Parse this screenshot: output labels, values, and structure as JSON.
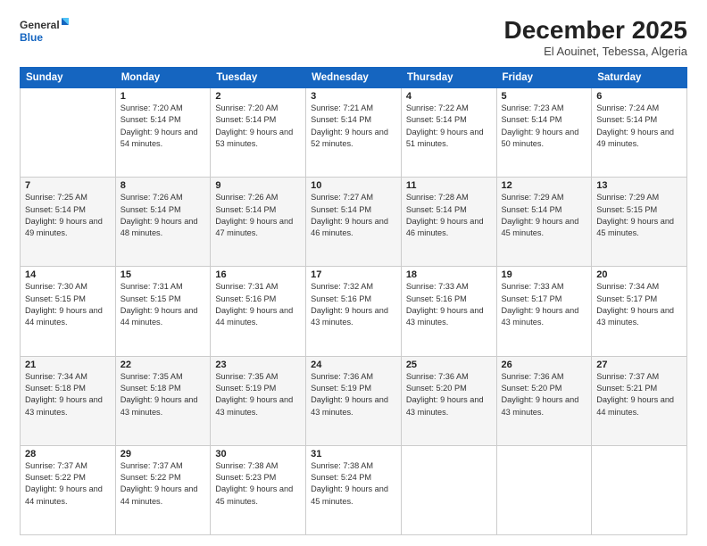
{
  "header": {
    "logo_line1": "General",
    "logo_line2": "Blue",
    "title": "December 2025",
    "subtitle": "El Aouinet, Tebessa, Algeria"
  },
  "days": [
    "Sunday",
    "Monday",
    "Tuesday",
    "Wednesday",
    "Thursday",
    "Friday",
    "Saturday"
  ],
  "weeks": [
    [
      {
        "num": "",
        "sunrise": "",
        "sunset": "",
        "daylight": ""
      },
      {
        "num": "1",
        "sunrise": "Sunrise: 7:20 AM",
        "sunset": "Sunset: 5:14 PM",
        "daylight": "Daylight: 9 hours and 54 minutes."
      },
      {
        "num": "2",
        "sunrise": "Sunrise: 7:20 AM",
        "sunset": "Sunset: 5:14 PM",
        "daylight": "Daylight: 9 hours and 53 minutes."
      },
      {
        "num": "3",
        "sunrise": "Sunrise: 7:21 AM",
        "sunset": "Sunset: 5:14 PM",
        "daylight": "Daylight: 9 hours and 52 minutes."
      },
      {
        "num": "4",
        "sunrise": "Sunrise: 7:22 AM",
        "sunset": "Sunset: 5:14 PM",
        "daylight": "Daylight: 9 hours and 51 minutes."
      },
      {
        "num": "5",
        "sunrise": "Sunrise: 7:23 AM",
        "sunset": "Sunset: 5:14 PM",
        "daylight": "Daylight: 9 hours and 50 minutes."
      },
      {
        "num": "6",
        "sunrise": "Sunrise: 7:24 AM",
        "sunset": "Sunset: 5:14 PM",
        "daylight": "Daylight: 9 hours and 49 minutes."
      }
    ],
    [
      {
        "num": "7",
        "sunrise": "Sunrise: 7:25 AM",
        "sunset": "Sunset: 5:14 PM",
        "daylight": "Daylight: 9 hours and 49 minutes."
      },
      {
        "num": "8",
        "sunrise": "Sunrise: 7:26 AM",
        "sunset": "Sunset: 5:14 PM",
        "daylight": "Daylight: 9 hours and 48 minutes."
      },
      {
        "num": "9",
        "sunrise": "Sunrise: 7:26 AM",
        "sunset": "Sunset: 5:14 PM",
        "daylight": "Daylight: 9 hours and 47 minutes."
      },
      {
        "num": "10",
        "sunrise": "Sunrise: 7:27 AM",
        "sunset": "Sunset: 5:14 PM",
        "daylight": "Daylight: 9 hours and 46 minutes."
      },
      {
        "num": "11",
        "sunrise": "Sunrise: 7:28 AM",
        "sunset": "Sunset: 5:14 PM",
        "daylight": "Daylight: 9 hours and 46 minutes."
      },
      {
        "num": "12",
        "sunrise": "Sunrise: 7:29 AM",
        "sunset": "Sunset: 5:14 PM",
        "daylight": "Daylight: 9 hours and 45 minutes."
      },
      {
        "num": "13",
        "sunrise": "Sunrise: 7:29 AM",
        "sunset": "Sunset: 5:15 PM",
        "daylight": "Daylight: 9 hours and 45 minutes."
      }
    ],
    [
      {
        "num": "14",
        "sunrise": "Sunrise: 7:30 AM",
        "sunset": "Sunset: 5:15 PM",
        "daylight": "Daylight: 9 hours and 44 minutes."
      },
      {
        "num": "15",
        "sunrise": "Sunrise: 7:31 AM",
        "sunset": "Sunset: 5:15 PM",
        "daylight": "Daylight: 9 hours and 44 minutes."
      },
      {
        "num": "16",
        "sunrise": "Sunrise: 7:31 AM",
        "sunset": "Sunset: 5:16 PM",
        "daylight": "Daylight: 9 hours and 44 minutes."
      },
      {
        "num": "17",
        "sunrise": "Sunrise: 7:32 AM",
        "sunset": "Sunset: 5:16 PM",
        "daylight": "Daylight: 9 hours and 43 minutes."
      },
      {
        "num": "18",
        "sunrise": "Sunrise: 7:33 AM",
        "sunset": "Sunset: 5:16 PM",
        "daylight": "Daylight: 9 hours and 43 minutes."
      },
      {
        "num": "19",
        "sunrise": "Sunrise: 7:33 AM",
        "sunset": "Sunset: 5:17 PM",
        "daylight": "Daylight: 9 hours and 43 minutes."
      },
      {
        "num": "20",
        "sunrise": "Sunrise: 7:34 AM",
        "sunset": "Sunset: 5:17 PM",
        "daylight": "Daylight: 9 hours and 43 minutes."
      }
    ],
    [
      {
        "num": "21",
        "sunrise": "Sunrise: 7:34 AM",
        "sunset": "Sunset: 5:18 PM",
        "daylight": "Daylight: 9 hours and 43 minutes."
      },
      {
        "num": "22",
        "sunrise": "Sunrise: 7:35 AM",
        "sunset": "Sunset: 5:18 PM",
        "daylight": "Daylight: 9 hours and 43 minutes."
      },
      {
        "num": "23",
        "sunrise": "Sunrise: 7:35 AM",
        "sunset": "Sunset: 5:19 PM",
        "daylight": "Daylight: 9 hours and 43 minutes."
      },
      {
        "num": "24",
        "sunrise": "Sunrise: 7:36 AM",
        "sunset": "Sunset: 5:19 PM",
        "daylight": "Daylight: 9 hours and 43 minutes."
      },
      {
        "num": "25",
        "sunrise": "Sunrise: 7:36 AM",
        "sunset": "Sunset: 5:20 PM",
        "daylight": "Daylight: 9 hours and 43 minutes."
      },
      {
        "num": "26",
        "sunrise": "Sunrise: 7:36 AM",
        "sunset": "Sunset: 5:20 PM",
        "daylight": "Daylight: 9 hours and 43 minutes."
      },
      {
        "num": "27",
        "sunrise": "Sunrise: 7:37 AM",
        "sunset": "Sunset: 5:21 PM",
        "daylight": "Daylight: 9 hours and 44 minutes."
      }
    ],
    [
      {
        "num": "28",
        "sunrise": "Sunrise: 7:37 AM",
        "sunset": "Sunset: 5:22 PM",
        "daylight": "Daylight: 9 hours and 44 minutes."
      },
      {
        "num": "29",
        "sunrise": "Sunrise: 7:37 AM",
        "sunset": "Sunset: 5:22 PM",
        "daylight": "Daylight: 9 hours and 44 minutes."
      },
      {
        "num": "30",
        "sunrise": "Sunrise: 7:38 AM",
        "sunset": "Sunset: 5:23 PM",
        "daylight": "Daylight: 9 hours and 45 minutes."
      },
      {
        "num": "31",
        "sunrise": "Sunrise: 7:38 AM",
        "sunset": "Sunset: 5:24 PM",
        "daylight": "Daylight: 9 hours and 45 minutes."
      },
      {
        "num": "",
        "sunrise": "",
        "sunset": "",
        "daylight": ""
      },
      {
        "num": "",
        "sunrise": "",
        "sunset": "",
        "daylight": ""
      },
      {
        "num": "",
        "sunrise": "",
        "sunset": "",
        "daylight": ""
      }
    ]
  ]
}
